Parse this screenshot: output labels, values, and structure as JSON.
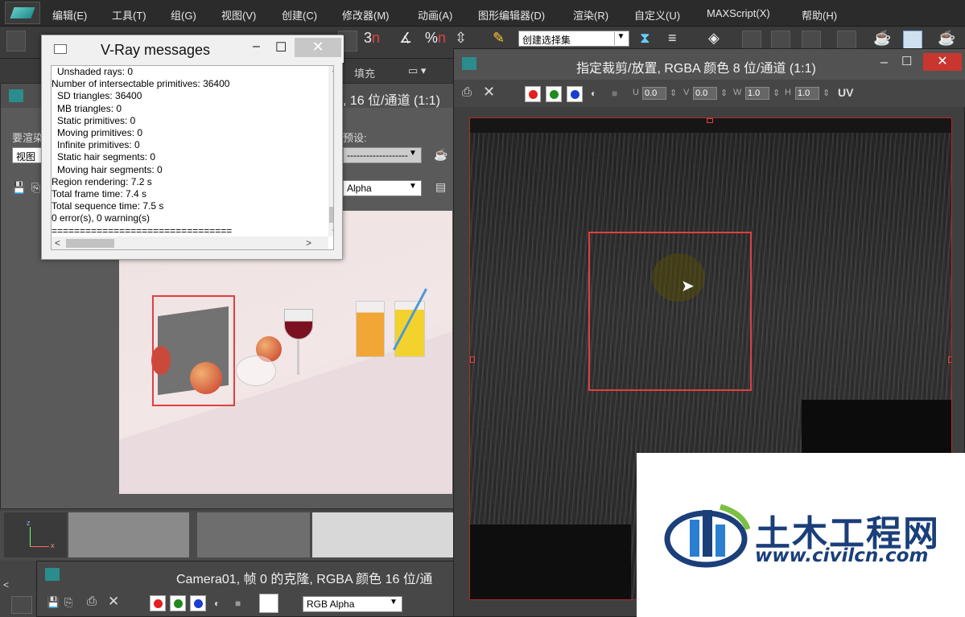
{
  "menubar": {
    "items": [
      "编辑(E)",
      "工具(T)",
      "组(G)",
      "视图(V)",
      "创建(C)",
      "修改器(M)",
      "动画(A)",
      "图形编辑器(D)",
      "渲染(R)",
      "自定义(U)",
      "MAXScript(X)",
      "帮助(H)"
    ]
  },
  "toolbar": {
    "selection_set_placeholder": "创建选择集",
    "percent_label": "%",
    "count_label": "3"
  },
  "left_window": {
    "title": ", 16 位/通道 (1:1)",
    "area_label": "要渲染",
    "view_value": "视图",
    "preset_label": "预设:",
    "preset_value": "-------------------",
    "channel_value": "Alpha",
    "fill_tab": "填充"
  },
  "vray": {
    "title": "V-Ray messages",
    "lines": [
      {
        "text": "Unshaded rays: 0",
        "indent": true
      },
      {
        "text": "Number of intersectable primitives: 36400",
        "indent": false
      },
      {
        "text": "SD triangles: 36400",
        "indent": true
      },
      {
        "text": "MB triangles: 0",
        "indent": true
      },
      {
        "text": "Static primitives: 0",
        "indent": true
      },
      {
        "text": "Moving primitives: 0",
        "indent": true
      },
      {
        "text": "Infinite primitives: 0",
        "indent": true
      },
      {
        "text": "Static hair segments: 0",
        "indent": true
      },
      {
        "text": "Moving hair segments: 0",
        "indent": true
      },
      {
        "text": "Region rendering: 7.2 s",
        "indent": false
      },
      {
        "text": "Total frame time: 7.4 s",
        "indent": false
      },
      {
        "text": "Total sequence time: 7.5 s",
        "indent": false
      },
      {
        "text": "0 error(s), 0 warning(s)",
        "indent": false
      },
      {
        "text": "================================",
        "indent": false
      }
    ]
  },
  "right_window": {
    "title": "指定裁剪/放置, RGBA 颜色 8 位/通道 (1:1)",
    "u_label": "U",
    "u_value": "0.0",
    "v_label": "V",
    "v_value": "0.0",
    "w_label": "W",
    "w_value": "1.0",
    "h_label": "H",
    "h_value": "1.0",
    "uv_label": "UV"
  },
  "camera_window": {
    "title": "Camera01, 帧 0 的克隆, RGBA 颜色 16 位/通",
    "channel_value": "RGB Alpha"
  },
  "watermark": {
    "name": "土木工程网",
    "url": "www.civilcn.com"
  },
  "colors": {
    "red_channel": "#e32020",
    "green_channel": "#1f8a1f",
    "blue_channel": "#1a3ed0",
    "region_box": "#e04040",
    "watermark_blue": "#1a3f7a"
  }
}
